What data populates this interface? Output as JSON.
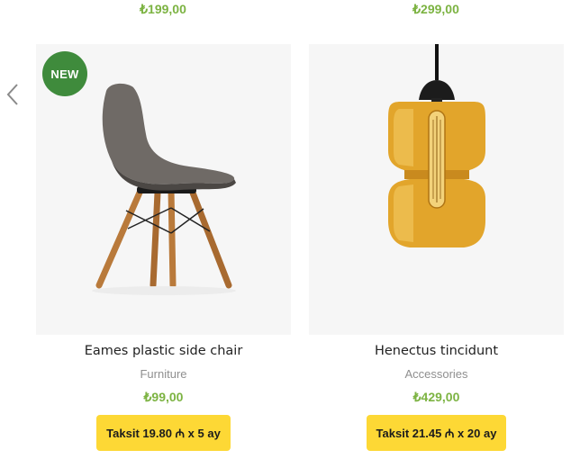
{
  "top_row": {
    "prices": [
      "₺199,00",
      "₺299,00"
    ]
  },
  "carousel": {
    "prev_icon": "chevron-left-icon"
  },
  "products": [
    {
      "badge": "NEW",
      "image_icon": "chair-image",
      "title": "Eames plastic side chair",
      "category": "Furniture",
      "price": "₺99,00",
      "installment": "Taksit 19.80 ₼ x 5 ay"
    },
    {
      "badge": "",
      "image_icon": "pendant-lamp-image",
      "title": "Henectus tincidunt",
      "category": "Accessories",
      "price": "₺429,00",
      "installment": "Taksit 21.45 ₼ x 20 ay"
    }
  ],
  "colors": {
    "price_green": "#7cb342",
    "badge_green": "#3f8b3c",
    "button_yellow": "#fdd835",
    "image_bg": "#f6f6f6"
  }
}
